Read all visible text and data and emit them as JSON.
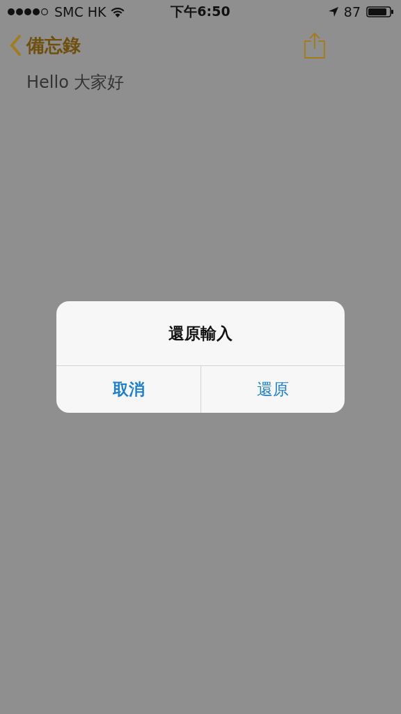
{
  "status_bar": {
    "carrier": "SMC HK",
    "time": "下午6:50",
    "battery": "87"
  },
  "nav": {
    "back": "備忘錄"
  },
  "note": {
    "text": "Hello 大家好"
  },
  "alert": {
    "title": "還原輸入",
    "buttons": [
      {
        "label": "取消",
        "kind": "cancel"
      },
      {
        "label": "還原",
        "kind": "default"
      }
    ]
  }
}
